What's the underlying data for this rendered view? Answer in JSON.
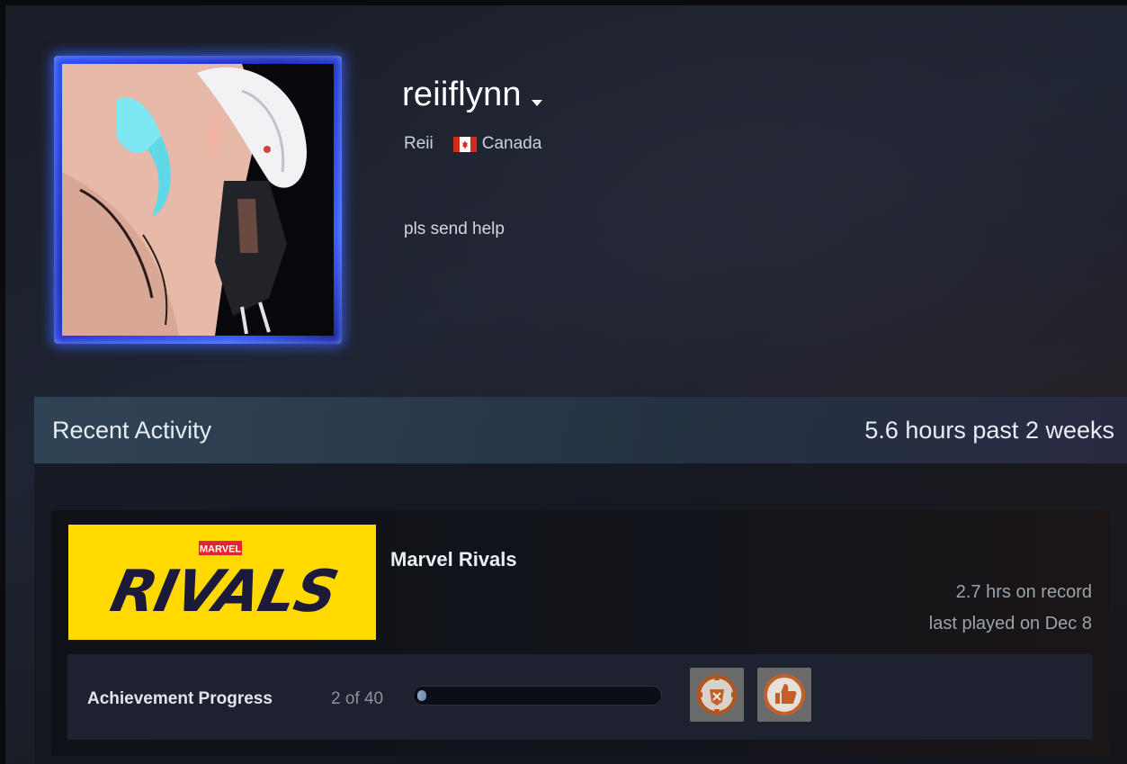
{
  "profile": {
    "persona_name": "reiiflynn",
    "real_name": "Reii",
    "country": "Canada",
    "summary": "pls send help",
    "avatar_icon": "anime-avatar-image",
    "frame_color": "#2f55ff"
  },
  "recent_activity": {
    "title": "Recent Activity",
    "hours_summary": "5.6 hours past 2 weeks",
    "games": [
      {
        "name": "Marvel Rivals",
        "capsule_brand": "MARVEL",
        "capsule_title": "RIVALS",
        "capsule_color": "#ffd900",
        "hours_on_record": "2.7 hrs on record",
        "last_played": "last played on Dec 8",
        "achievements": {
          "label": "Achievement Progress",
          "count_text": "2 of 40",
          "progress_fraction": 0.05,
          "icons": [
            "compass-emblem-achievement-icon",
            "thumbs-up-achievement-icon"
          ]
        }
      }
    ]
  }
}
